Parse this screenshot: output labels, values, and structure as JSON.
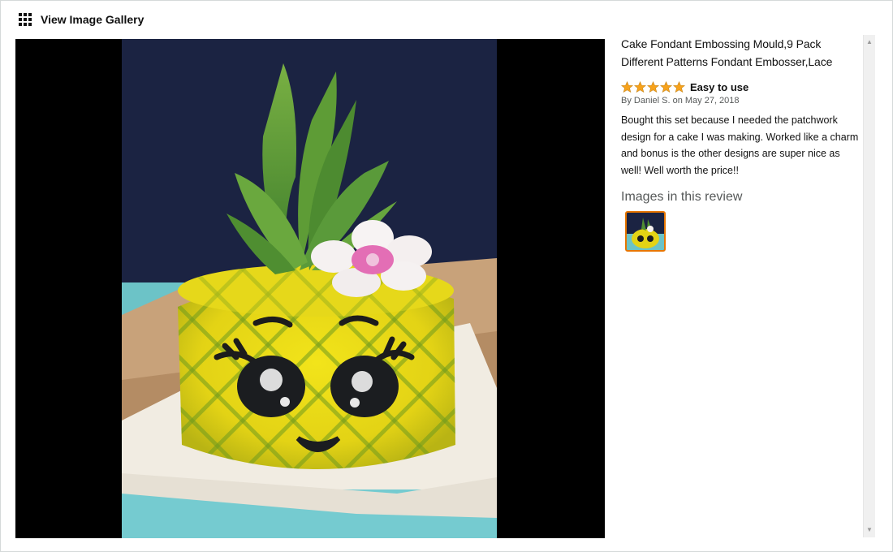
{
  "header": {
    "gallery_link_label": "View Image Gallery",
    "gallery_icon": "grid-icon"
  },
  "review": {
    "product_title": "Cake Fondant Embossing Mould,9 Pack Different Patterns Fondant Embosser,Lace",
    "rating": 5,
    "rating_max": 5,
    "star_color": "#f7a21b",
    "title": "Easy to use",
    "byline": "By Daniel S. on May 27, 2018",
    "body": "Bought this set because I needed the patchwork design for a cake I was making. Worked like a charm and bonus is the other designs are super nice as well! Well worth the price!!",
    "images_heading": "Images in this review",
    "thumbnail_selected_color": "#e77600"
  },
  "viewer": {
    "image_description_icon": "pineapple-cake-photo"
  },
  "scrollbar": {
    "up_icon": "scroll-up-arrow-icon",
    "down_icon": "scroll-down-arrow-icon"
  }
}
